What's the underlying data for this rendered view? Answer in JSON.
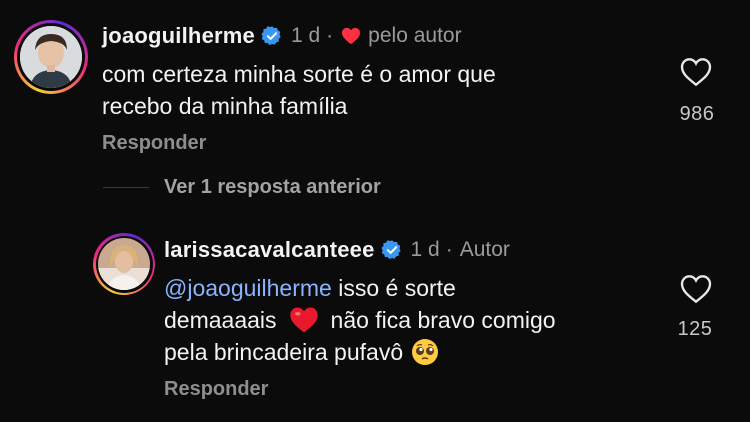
{
  "comments": [
    {
      "username": "joaoguilherme",
      "verified": true,
      "time": "1 d",
      "separator": "·",
      "liked_by_author_label": "pelo autor",
      "text_line1": "com certeza minha sorte é o amor que",
      "text_line2": "recebo da minha família",
      "like_count": "986",
      "reply_label": "Responder"
    },
    {
      "username": "larissacavalcanteee",
      "verified": true,
      "time": "1 d",
      "separator": "·",
      "author_badge": "Autor",
      "mention": "@joaoguilherme",
      "text_line1_rest": " isso é sorte",
      "text_line2_a": "demaaaais",
      "text_line2_b": "não fica bravo comigo",
      "text_line3": "pela brincadeira pufavô",
      "like_count": "125",
      "reply_label": "Responder"
    }
  ],
  "view_previous_replies": "Ver 1 resposta anterior",
  "colors": {
    "background": "#0b0b0c",
    "verified_blue": "#3897f0",
    "heart_red": "#ff3040",
    "mention_blue": "#8ab4ff"
  },
  "icons": [
    "verified-badge-icon",
    "heart-filled-icon",
    "heart-outline-icon",
    "red-heart-emoji",
    "pleading-face-emoji"
  ]
}
